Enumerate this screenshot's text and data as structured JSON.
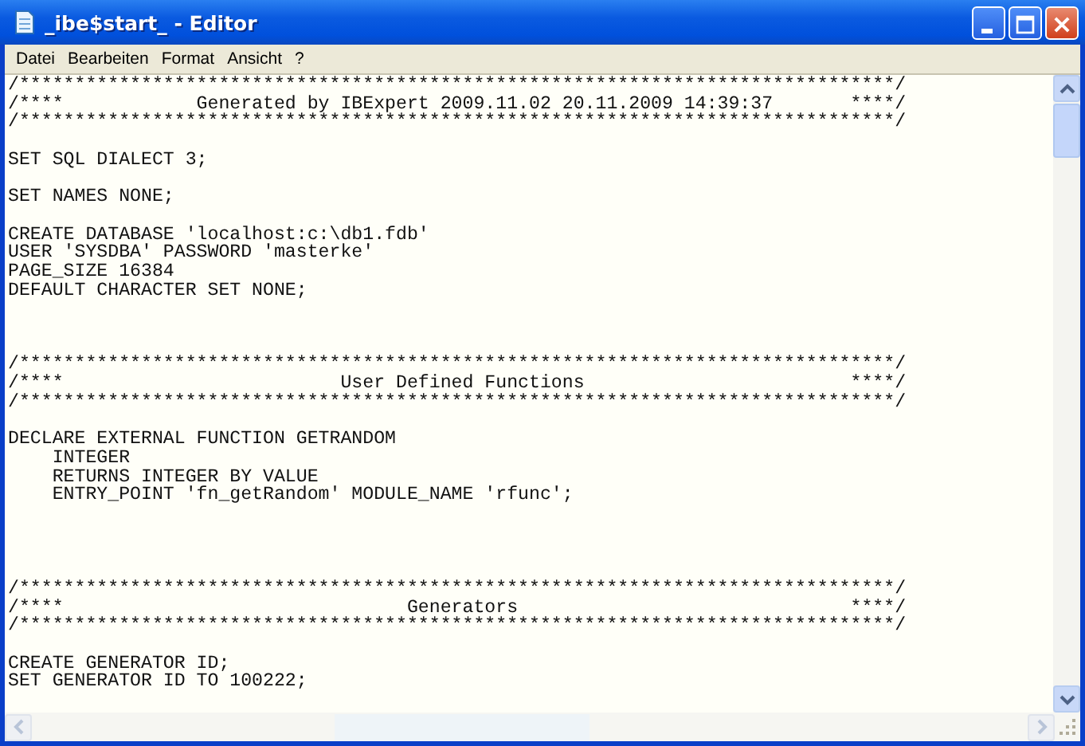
{
  "window": {
    "title": "_ibe$start_ - Editor"
  },
  "menu": [
    {
      "label": "Datei"
    },
    {
      "label": "Bearbeiten"
    },
    {
      "label": "Format"
    },
    {
      "label": "Ansicht"
    },
    {
      "label": "?"
    }
  ],
  "lines": [
    {
      "kind": "code",
      "text": "/*******************************************************************************/"
    },
    {
      "kind": "code",
      "text": "/****            Generated by IBExpert 2009.11.02 20.11.2009 14:39:37       ****/"
    },
    {
      "kind": "code",
      "text": "/*******************************************************************************/"
    },
    {
      "kind": "blank"
    },
    {
      "kind": "code",
      "text": "SET SQL DIALECT 3;"
    },
    {
      "kind": "blank"
    },
    {
      "kind": "code",
      "text": "SET NAMES NONE;"
    },
    {
      "kind": "blank"
    },
    {
      "kind": "code",
      "text": "CREATE DATABASE 'localhost:c:\\db1.fdb'"
    },
    {
      "kind": "code",
      "text": "USER 'SYSDBA' PASSWORD 'masterke'"
    },
    {
      "kind": "code",
      "text": "PAGE_SIZE 16384"
    },
    {
      "kind": "code",
      "text": "DEFAULT CHARACTER SET NONE;"
    },
    {
      "kind": "blank"
    },
    {
      "kind": "blank"
    },
    {
      "kind": "blank"
    },
    {
      "kind": "code",
      "text": "/*******************************************************************************/"
    },
    {
      "kind": "code",
      "text": "/****                         User Defined Functions                        ****/"
    },
    {
      "kind": "code",
      "text": "/*******************************************************************************/"
    },
    {
      "kind": "blank"
    },
    {
      "kind": "code",
      "text": "DECLARE EXTERNAL FUNCTION GETRANDOM"
    },
    {
      "kind": "code",
      "text": "    INTEGER"
    },
    {
      "kind": "code",
      "text": "    RETURNS INTEGER BY VALUE"
    },
    {
      "kind": "code",
      "text": "    ENTRY_POINT 'fn_getRandom' MODULE_NAME 'rfunc';"
    },
    {
      "kind": "blank"
    },
    {
      "kind": "blank"
    },
    {
      "kind": "blank"
    },
    {
      "kind": "blank"
    },
    {
      "kind": "code",
      "text": "/*******************************************************************************/"
    },
    {
      "kind": "code",
      "text": "/****                               Generators                              ****/"
    },
    {
      "kind": "code",
      "text": "/*******************************************************************************/"
    },
    {
      "kind": "blank"
    },
    {
      "kind": "code",
      "text": "CREATE GENERATOR ID;"
    },
    {
      "kind": "code",
      "text": "SET GENERATOR ID TO 100222;"
    }
  ]
}
